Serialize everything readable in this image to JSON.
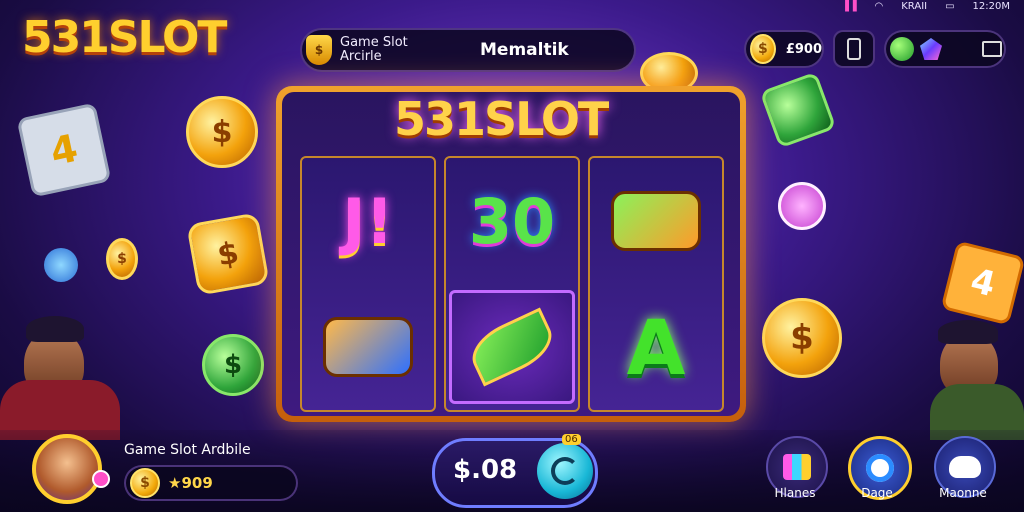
{
  "status_bar": {
    "signal": "▐▐",
    "wifi": "◠",
    "time": "12:20M",
    "net": "KRAII",
    "battery": "▭"
  },
  "logo": {
    "text": "531SLOT"
  },
  "topbar": {
    "game_title_line1": "Game Slot",
    "game_title_line2": "Arcirle",
    "machine_name": "Memaltik",
    "coins": "£900"
  },
  "machine": {
    "logo": "531SLOT",
    "reels": [
      [
        "J!",
        "cannon-blue"
      ],
      [
        "30",
        "leaf"
      ],
      [
        "cannon-green",
        "A"
      ]
    ]
  },
  "decor": {
    "card_left": "4",
    "card_right": "4",
    "coin_symbol": "$"
  },
  "player": {
    "name": "Game Slot Ardbile",
    "balance": "★909"
  },
  "bet": {
    "value": "$.08",
    "tag": "06"
  },
  "nav": {
    "left_label": "Hlanes",
    "mid_label": "Dage",
    "right_label": "Maonne"
  },
  "colors": {
    "accent_gold": "#ffcf2e",
    "accent_purple": "#7a3fd6",
    "spin_cyan": "#18b7d6"
  }
}
